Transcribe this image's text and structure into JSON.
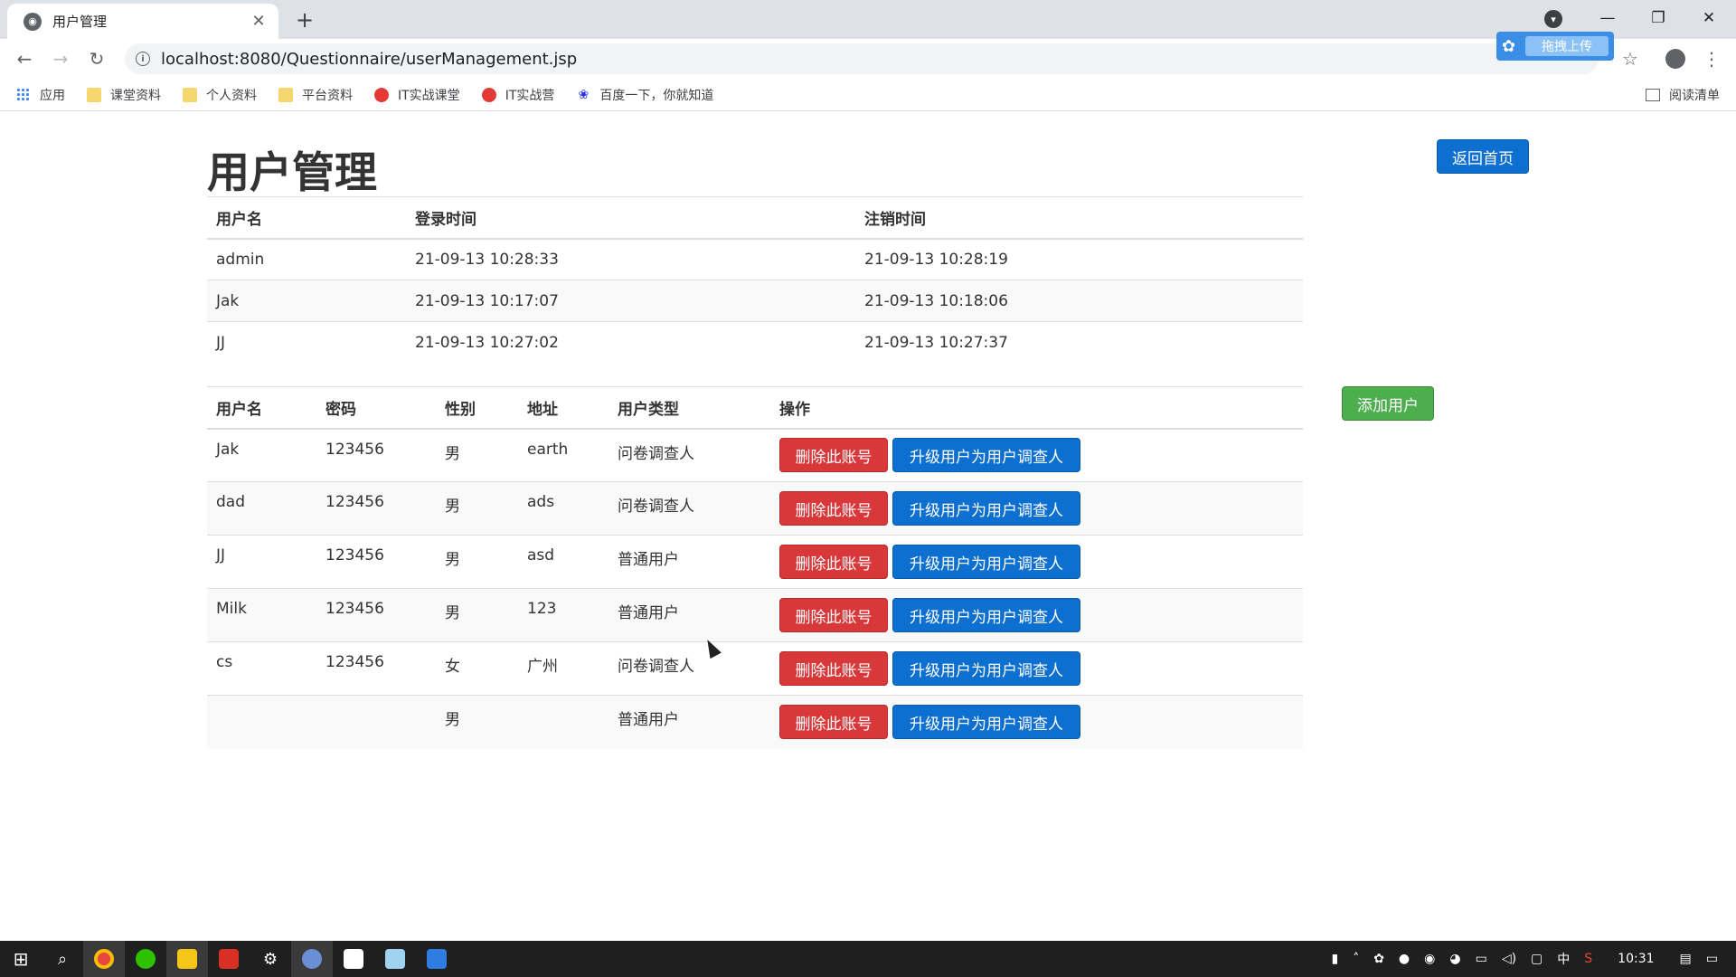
{
  "browser": {
    "tab_title": "用户管理",
    "url": "localhost:8080/Questionnaire/userManagement.jsp",
    "upload_label": "拖拽上传",
    "bookmarks": [
      "应用",
      "课堂资料",
      "个人资料",
      "平台资料",
      "IT实战课堂",
      "IT实战营",
      "百度一下，你就知道"
    ],
    "reading_list": "阅读清单"
  },
  "page": {
    "title": "用户管理",
    "home_button": "返回首页",
    "add_user_button": "添加用户"
  },
  "login_table": {
    "headers": [
      "用户名",
      "登录时间",
      "注销时间"
    ],
    "rows": [
      [
        "admin",
        "21-09-13 10:28:33",
        "21-09-13 10:28:19"
      ],
      [
        "Jak",
        "21-09-13 10:17:07",
        "21-09-13 10:18:06"
      ],
      [
        "JJ",
        "21-09-13 10:27:02",
        "21-09-13 10:27:37"
      ]
    ]
  },
  "user_table": {
    "headers": [
      "用户名",
      "密码",
      "性别",
      "地址",
      "用户类型",
      "操作"
    ],
    "delete_label": "删除此账号",
    "upgrade_label": "升级用户为用户调查人",
    "rows": [
      [
        "Jak",
        "123456",
        "男",
        "earth",
        "问卷调查人"
      ],
      [
        "dad",
        "123456",
        "男",
        "ads",
        "问卷调查人"
      ],
      [
        "JJ",
        "123456",
        "男",
        "asd",
        "普通用户"
      ],
      [
        "Milk",
        "123456",
        "男",
        "123",
        "普通用户"
      ],
      [
        "cs",
        "123456",
        "女",
        "广州",
        "问卷调查人"
      ],
      [
        "",
        "",
        "男",
        "",
        "普通用户"
      ]
    ]
  },
  "taskbar": {
    "ime": "中",
    "clock": "10:31"
  },
  "colors": {
    "primary": "#0d6fcf",
    "success": "#4cae4c",
    "danger": "#d9383a"
  }
}
